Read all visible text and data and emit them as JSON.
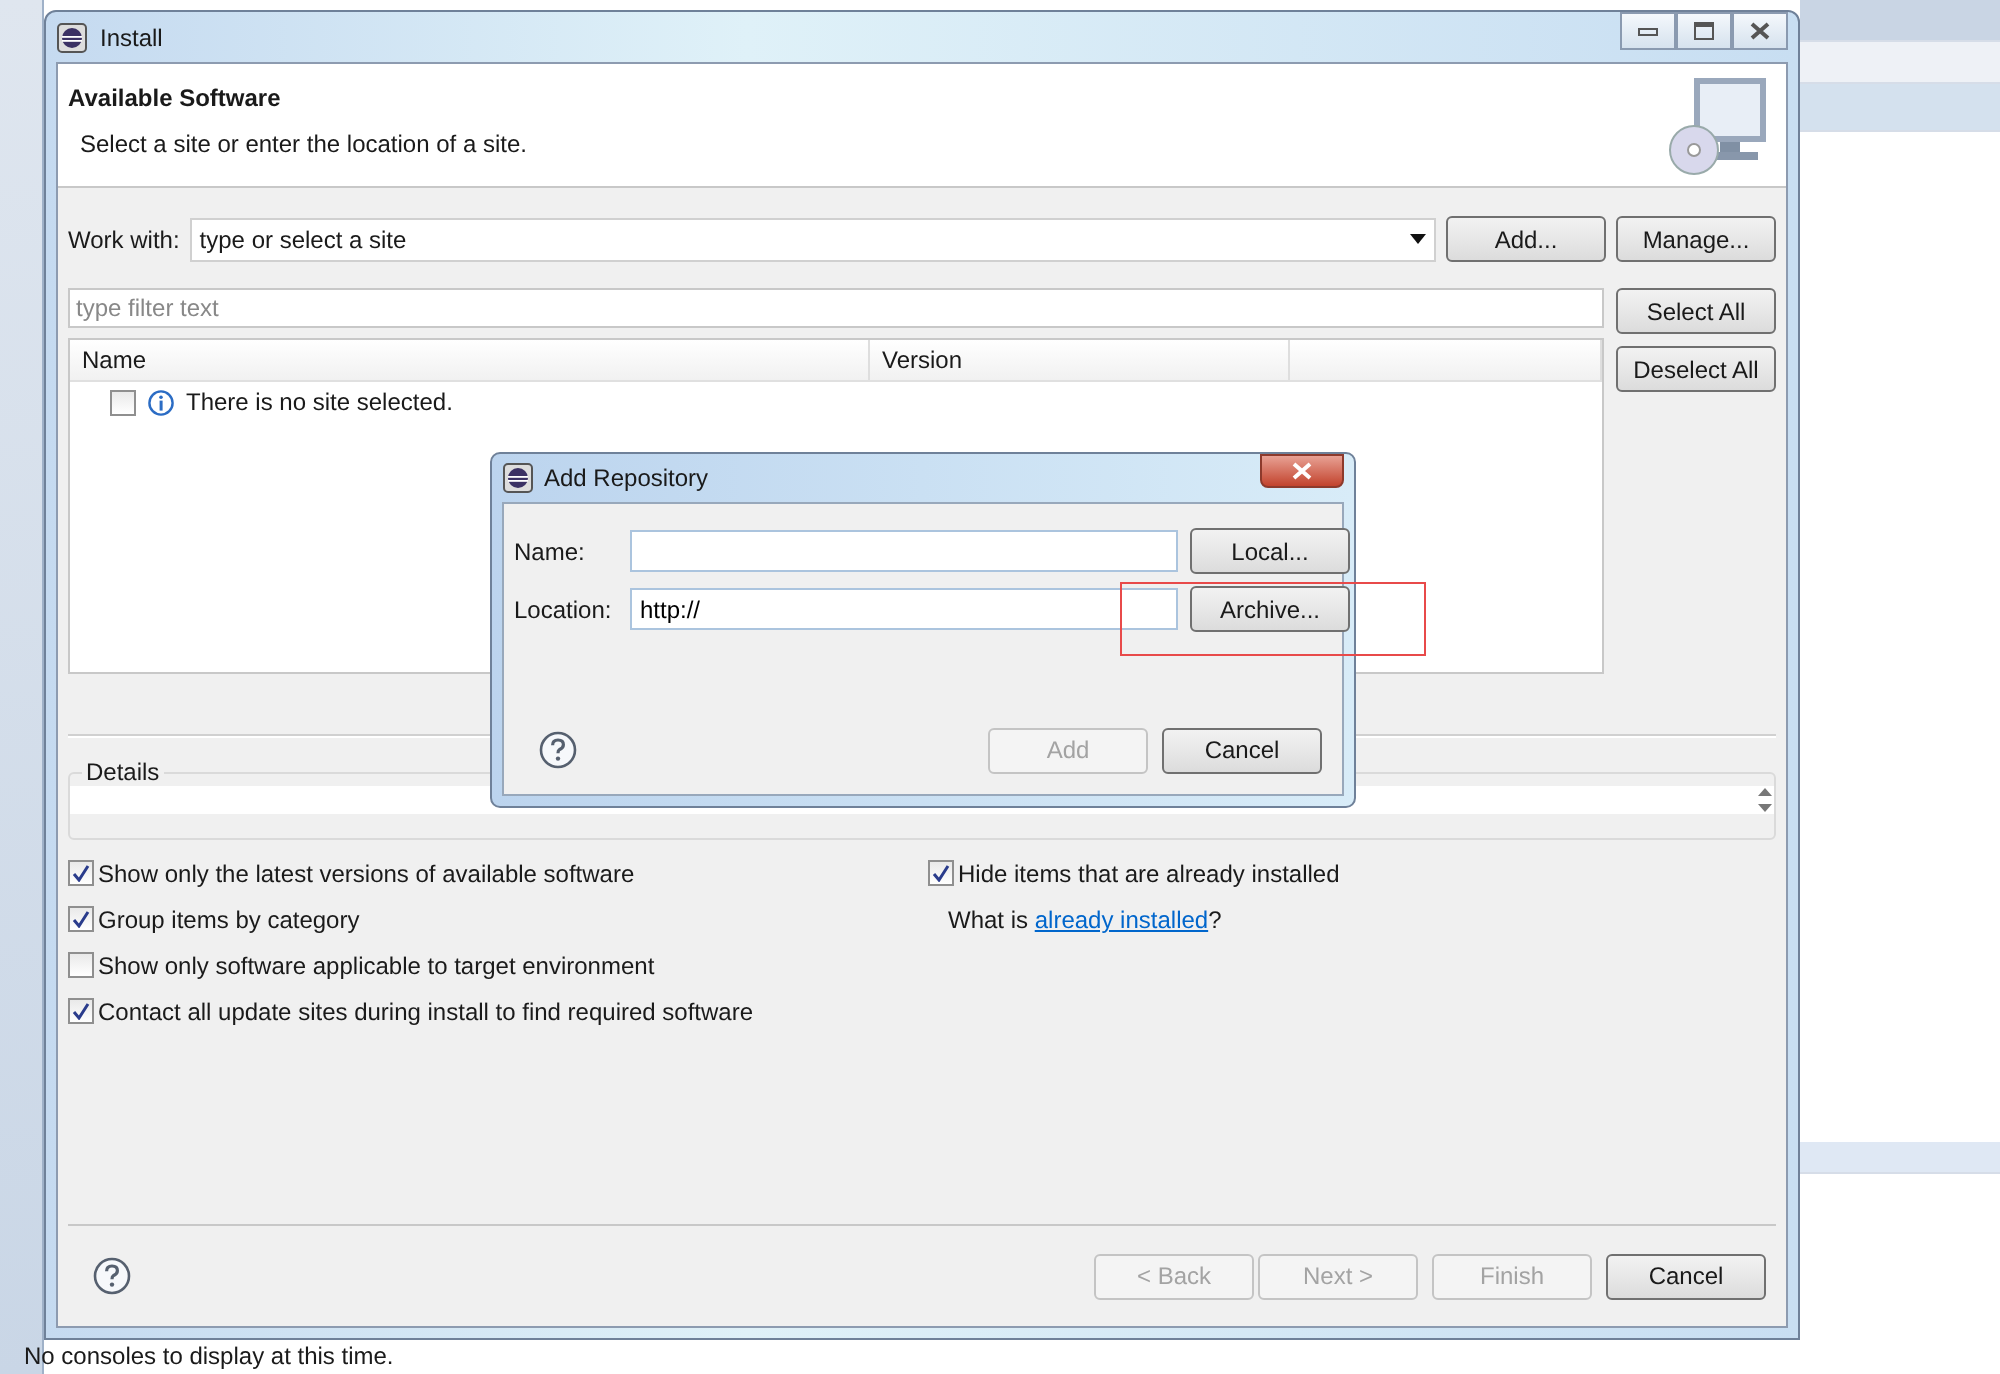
{
  "ide": {
    "status_text": "No consoles to display at this time."
  },
  "window": {
    "title": "Install"
  },
  "header": {
    "title": "Available Software",
    "subtitle": "Select a site or enter the location of a site."
  },
  "work_with": {
    "label": "Work with:",
    "placeholder": "type or select a site",
    "buttons": [
      "Add...",
      "Manage..."
    ]
  },
  "filter": {
    "placeholder": "type filter text"
  },
  "table": {
    "columns": [
      "Name",
      "Version"
    ],
    "rows": [
      {
        "text": "There is no site selected.",
        "checked": false
      }
    ]
  },
  "list_buttons": [
    "Select All",
    "Deselect All"
  ],
  "details": {
    "label": "Details"
  },
  "options_left": [
    {
      "label": "Show only the latest versions of available software",
      "checked": true
    },
    {
      "label": "Group items by category",
      "checked": true
    },
    {
      "label": "Show only software applicable to target environment",
      "checked": false
    },
    {
      "label": "Contact all update sites during install to find required software",
      "checked": true
    }
  ],
  "options_right": [
    {
      "label": "Hide items that are already installed",
      "checked": true
    }
  ],
  "installed_note": {
    "text": "What is",
    "link": "already installed",
    "suffix": "?"
  },
  "footer_buttons": [
    {
      "label": "< Back",
      "disabled": true
    },
    {
      "label": "Next >",
      "disabled": true
    },
    {
      "label": "Finish",
      "disabled": true
    },
    {
      "label": "Cancel",
      "disabled": false
    }
  ],
  "dialog": {
    "title": "Add Repository",
    "fields": [
      {
        "label": "Name:",
        "button": "Local..."
      },
      {
        "label": "Location:",
        "value": "http://",
        "button": "Archive..."
      }
    ],
    "buttons": [
      {
        "label": "Add",
        "disabled": true
      },
      {
        "label": "Cancel",
        "disabled": false
      }
    ]
  }
}
